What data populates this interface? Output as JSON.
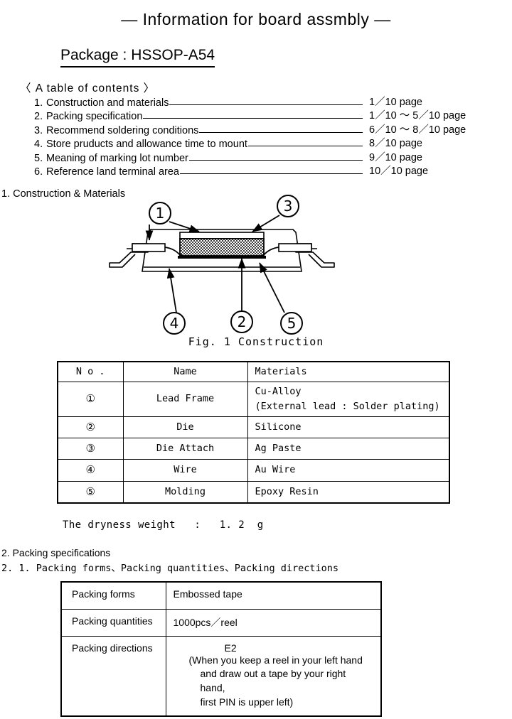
{
  "header": {
    "title": "—  Information for board assmbly  —",
    "package_line": "Package  :  HSSOP-A54"
  },
  "toc": {
    "heading": "〈 A  table  of  contents 〉",
    "items": [
      {
        "num": "1.",
        "label": "Construction and materials",
        "page": "1／10 page"
      },
      {
        "num": "2.",
        "label": "Packing specification",
        "page": "1／10 ～ 5／10 page"
      },
      {
        "num": "3.",
        "label": "Recommend soldering conditions",
        "page": "6／10 ～ 8／10 page"
      },
      {
        "num": "4.",
        "label": "Store pruducts and allowance time to mount",
        "page": "8／10 page"
      },
      {
        "num": "5.",
        "label": "Meaning of marking lot number",
        "page": "9／10 page"
      },
      {
        "num": "6.",
        "label": "Reference land terminal area",
        "page": "10／10 page"
      }
    ]
  },
  "section1": {
    "heading": "1. Construction & Materials",
    "figure_caption": "Fig. 1  Construction",
    "callouts": [
      {
        "id": "1",
        "glyph": "①"
      },
      {
        "id": "2",
        "glyph": "②"
      },
      {
        "id": "3",
        "glyph": "③"
      },
      {
        "id": "4",
        "glyph": "④"
      },
      {
        "id": "5",
        "glyph": "⑤"
      }
    ],
    "materials_table": {
      "headers": [
        "N o .",
        "Name",
        "Materials"
      ],
      "rows": [
        {
          "no": "①",
          "name": "Lead Frame",
          "material_line1": "Cu-Alloy",
          "material_line2": "(External lead  :  Solder plating)"
        },
        {
          "no": "②",
          "name": "Die",
          "material_line1": "Silicone",
          "material_line2": ""
        },
        {
          "no": "③",
          "name": "Die Attach",
          "material_line1": "Ag Paste",
          "material_line2": ""
        },
        {
          "no": "④",
          "name": "Wire",
          "material_line1": "Au Wire",
          "material_line2": ""
        },
        {
          "no": "⑤",
          "name": "Molding",
          "material_line1": "Epoxy Resin",
          "material_line2": ""
        }
      ]
    },
    "dryness_weight": "The dryness weight   :   1. 2  g"
  },
  "section2": {
    "heading": "2. Packing  specifications",
    "subheading": "2. 1. Packing  forms、Packing  quantities、Packing  directions",
    "packing_table": {
      "rows": [
        {
          "label": "Packing forms",
          "value": "Embossed  tape"
        },
        {
          "label": "Packing quantities",
          "value": "1000pcs／reel"
        },
        {
          "label": "Packing directions",
          "value": "E2",
          "note_line1": "(When you keep a reel in your left hand",
          "note_line2": "and draw out a tape by your right hand,",
          "note_line3": "first PIN is upper left)"
        }
      ]
    }
  }
}
